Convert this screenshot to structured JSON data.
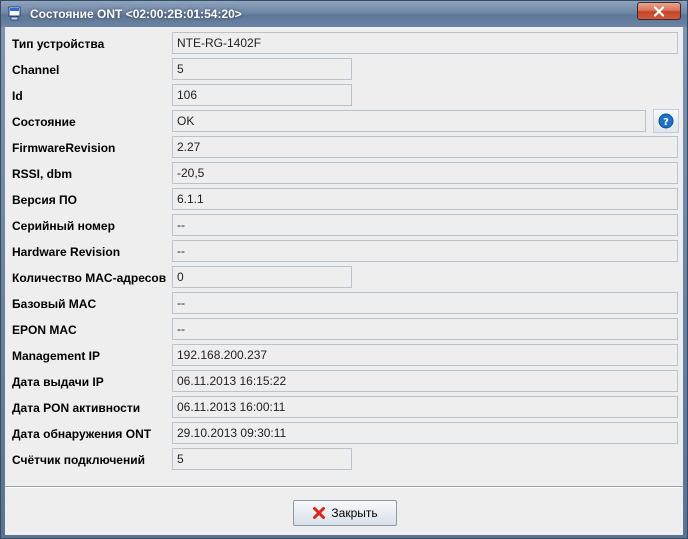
{
  "window": {
    "title": "Состояние ONT <02:00:2B:01:54:20>",
    "close_glyph": "✕"
  },
  "fields": [
    {
      "label": "Тип устройства",
      "value": "NTE-RG-1402F"
    },
    {
      "label": "Channel",
      "value": "5"
    },
    {
      "label": "Id",
      "value": "106"
    },
    {
      "label": "Состояние",
      "value": "OK"
    },
    {
      "label": "FirmwareRevision",
      "value": "2.27"
    },
    {
      "label": "RSSI, dbm",
      "value": "-20,5"
    },
    {
      "label": "Версия ПО",
      "value": "6.1.1"
    },
    {
      "label": "Серийный номер",
      "value": "--"
    },
    {
      "label": "Hardware Revision",
      "value": "--"
    },
    {
      "label": "Количество MAC-адресов",
      "value": "0"
    },
    {
      "label": "Базовый MAC",
      "value": "--"
    },
    {
      "label": "EPON MAC",
      "value": "--"
    },
    {
      "label": "Management IP",
      "value": "192.168.200.237"
    },
    {
      "label": "Дата выдачи IP",
      "value": "06.11.2013 16:15:22"
    },
    {
      "label": "Дата PON активности",
      "value": "06.11.2013 16:00:11"
    },
    {
      "label": "Дата обнаружения ONT",
      "value": "29.10.2013 09:30:11"
    },
    {
      "label": "Счётчик подключений",
      "value": "5"
    }
  ],
  "help_icon": "help-icon",
  "footer": {
    "close_label": "Закрыть",
    "close_icon": "red-x-icon"
  },
  "colors": {
    "title_bar": "#6f87a6",
    "close_button": "#c3452a",
    "field_border": "#b8c4cd",
    "help_icon": "#1f6fc4",
    "close_icon": "#d9251c"
  }
}
